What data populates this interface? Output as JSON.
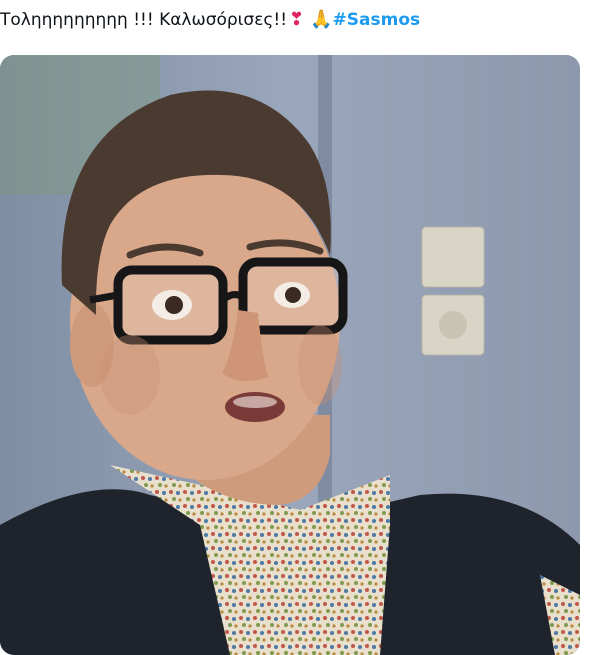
{
  "tweet": {
    "text": "Τοληηηηηηηηη !!! Καλωσόρισες!!",
    "heart_emoji": "❣",
    "pray_emoji": "🙏",
    "hashtag": "#Sasmos"
  },
  "media": {
    "alt_description": "",
    "colors": {
      "background_wall": "#8f9bb1",
      "shirt": "#e6dcc9",
      "vest": "#1f232c",
      "skin": "#d9a88a",
      "hair": "#4a3a30",
      "glasses": "#161616"
    }
  },
  "icons": [
    "heart-emoji-icon",
    "praying-hands-emoji-icon"
  ]
}
